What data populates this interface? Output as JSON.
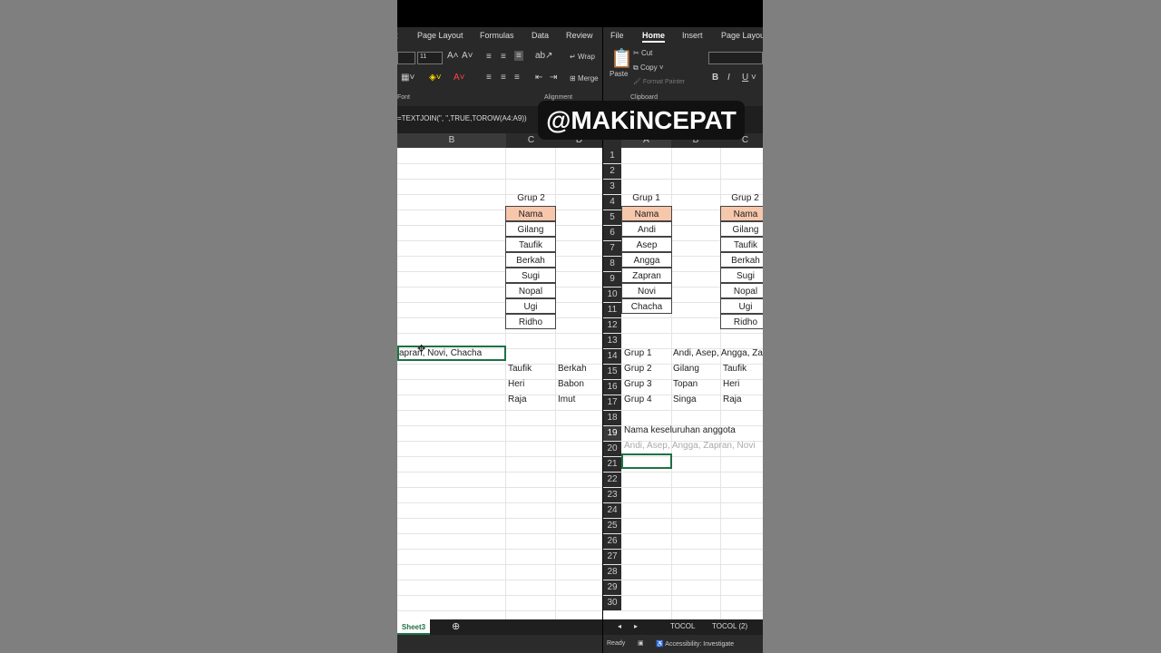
{
  "banner": "@MAKiNCEPAT",
  "left": {
    "menu": [
      "t",
      "Page Layout",
      "Formulas",
      "Data",
      "Review"
    ],
    "font_size": "11",
    "wrap_label": "Wrap",
    "merge_label": "Merge",
    "group_font": "Font",
    "group_alignment": "Alignment",
    "formula": "=TEXTJOIN(\", \",TRUE,TOROW(A4:A9))",
    "columns": [
      "B",
      "C",
      "D"
    ],
    "c_grup": "Grup 2",
    "c_header": "Nama",
    "c_names": [
      "Gilang",
      "Taufik",
      "Berkah",
      "Sugi",
      "Nopal",
      "Ugi",
      "Ridho"
    ],
    "b12": "apran, Novi, Chacha",
    "row13": [
      "Taufik",
      "Berkah"
    ],
    "row14": [
      "Heri",
      "Babon"
    ],
    "row15": [
      "Raja",
      "Imut"
    ],
    "sheet_tab": "Sheet3"
  },
  "right": {
    "menu": [
      "File",
      "Home",
      "Insert",
      "Page Layou"
    ],
    "paste_label": "Paste",
    "cut_label": "Cut",
    "copy_label": "Copy",
    "format_painter": "Format Painter",
    "group_clipboard": "Clipboard",
    "columns": [
      "A",
      "B",
      "C"
    ],
    "row_numbers": [
      "1",
      "2",
      "3",
      "4",
      "5",
      "6",
      "7",
      "8",
      "9",
      "10",
      "11",
      "12",
      "13",
      "14",
      "15",
      "16",
      "17",
      "18",
      "19",
      "20",
      "21",
      "22",
      "23",
      "24",
      "25",
      "26",
      "27",
      "28",
      "29",
      "30"
    ],
    "a_grup": "Grup 1",
    "a_header": "Nama",
    "a_names": [
      "Andi",
      "Asep",
      "Angga",
      "Zapran",
      "Novi",
      "Chacha"
    ],
    "c_grup": "Grup 2",
    "c_header": "Nama",
    "c_names": [
      "Gilang",
      "Taufik",
      "Berkah",
      "Sugi",
      "Nopal",
      "Ugi",
      "Ridho"
    ],
    "groups": [
      {
        "label": "Grup 1",
        "b": "Andi, Asep, Angga, Za",
        "c": ""
      },
      {
        "label": "Grup 2",
        "b": "Gilang",
        "c": "Taufik"
      },
      {
        "label": "Grup 3",
        "b": "Topan",
        "c": "Heri"
      },
      {
        "label": "Grup 4",
        "b": "Singa",
        "c": "Raja"
      }
    ],
    "a17": "Nama keseluruhan anggota",
    "a18": "Andi, Asep, Angga, Zapran, Novi",
    "tabs": [
      "TOCOL",
      "TOCOL (2)"
    ],
    "status_ready": "Ready",
    "status_access": "Accessibility: Investigate"
  }
}
